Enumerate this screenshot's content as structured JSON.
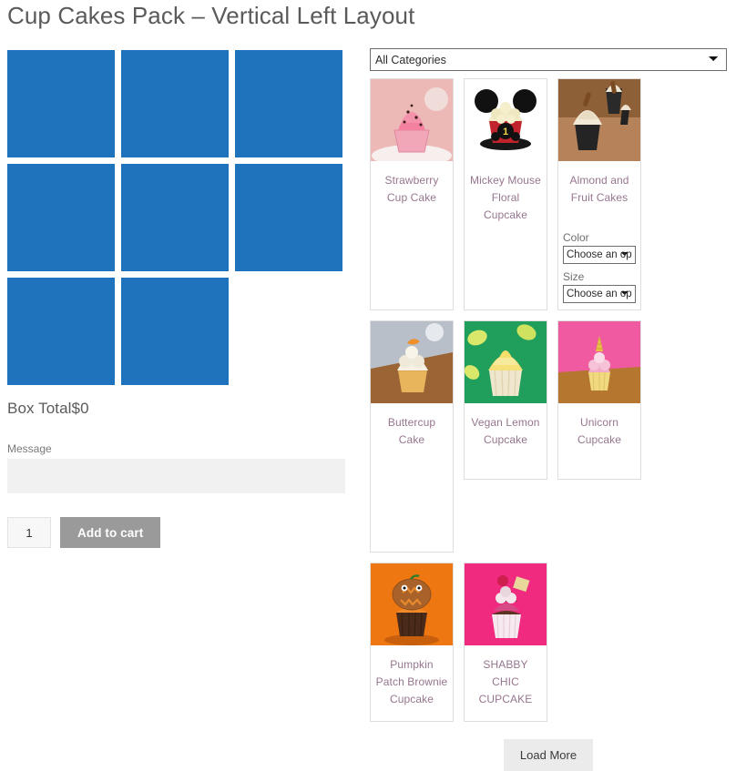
{
  "page": {
    "title": "Cup Cakes Pack – Vertical Left Layout"
  },
  "box_builder": {
    "slot_count": 8,
    "slot_color": "#1f73bd",
    "box_total_label": "Box Total",
    "box_total_value": "$0",
    "message_label": "Message",
    "message_value": "",
    "message_placeholder": "",
    "quantity_value": "1",
    "add_to_cart_label": "Add to cart"
  },
  "picker": {
    "category_select": {
      "selected": "All Categories",
      "options": [
        "All Categories"
      ]
    },
    "load_more_label": "Load More",
    "products": [
      {
        "name": "Strawberry Cup Cake",
        "row": 1,
        "image": "strawberry-cup-cake-thumb",
        "variations": []
      },
      {
        "name": "Mickey Mouse Floral Cupcake",
        "row": 1,
        "image": "mickey-mouse-floral-cupcake-thumb",
        "variations": []
      },
      {
        "name": "Almond and Fruit Cakes",
        "row": 1,
        "image": "almond-and-fruit-cakes-thumb",
        "variations": [
          {
            "label": "Color",
            "selected": "Choose an option",
            "options": [
              "Choose an option"
            ]
          },
          {
            "label": "Size",
            "selected": "Choose an option",
            "options": [
              "Choose an option"
            ]
          }
        ]
      },
      {
        "name": "Buttercup Cake",
        "row": 1,
        "image": "buttercup-cake-thumb",
        "variations": []
      },
      {
        "name": "Vegan Lemon Cupcake",
        "row": 2,
        "image": "vegan-lemon-cupcake-thumb",
        "variations": []
      },
      {
        "name": "Unicorn Cupcake",
        "row": 2,
        "image": "unicorn-cupcake-thumb",
        "variations": []
      },
      {
        "name": "Pumpkin Patch Brownie Cupcake",
        "row": 2,
        "image": "pumpkin-patch-brownie-cupcake-thumb",
        "variations": []
      },
      {
        "name": "SHABBY CHIC CUPCAKE",
        "row": 2,
        "image": "shabby-chic-cupcake-thumb",
        "variations": []
      }
    ]
  }
}
